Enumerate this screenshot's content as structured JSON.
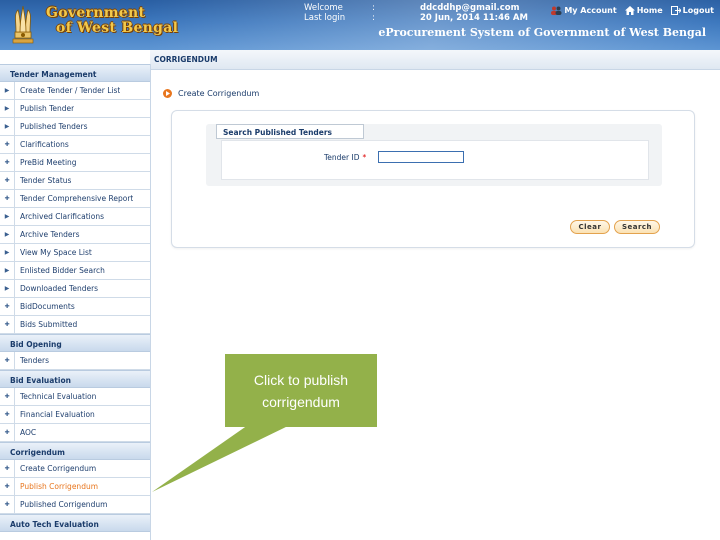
{
  "header": {
    "gov_line1": "Government",
    "gov_line2": "of West Bengal",
    "welcome_label": "Welcome",
    "welcome_value": "ddcddhp@gmail.com",
    "lastlogin_label": "Last login",
    "lastlogin_value": "20 Jun, 2014 11:46 AM",
    "colon": ":",
    "my_account": "My Account",
    "home": "Home",
    "logout": "Logout",
    "system_title": "eProcurement System of Government of West Bengal"
  },
  "breadcrumb": "CORRIGENDUM",
  "sidebar": {
    "tender_management": {
      "title": "Tender Management",
      "items": [
        "Create Tender / Tender List",
        "Publish Tender",
        "Published Tenders",
        "Clarifications",
        "PreBid Meeting",
        "Tender Status",
        "Tender Comprehensive Report",
        "Archived Clarifications",
        "Archive Tenders",
        "View My Space List",
        "Enlisted Bidder Search",
        "Downloaded Tenders",
        "BidDocuments",
        "Bids Submitted"
      ]
    },
    "bid_opening": {
      "title": "Bid Opening",
      "items": [
        "Tenders"
      ]
    },
    "bid_evaluation": {
      "title": "Bid Evaluation",
      "items": [
        "Technical Evaluation",
        "Financial Evaluation",
        "AOC"
      ]
    },
    "corrigendum": {
      "title": "Corrigendum",
      "items": [
        "Create Corrigendum",
        "Publish Corrigendum",
        "Published Corrigendum"
      ]
    },
    "auto_tech": {
      "title": "Auto Tech Evaluation"
    }
  },
  "main": {
    "heading": "Create Corrigendum",
    "search_legend": "Search Published Tenders",
    "tender_id_label": "Tender ID",
    "required_mark": "*",
    "tender_id_value": "",
    "clear_label": "Clear",
    "search_label": "Search"
  },
  "callout": {
    "text": "Click to publish corrigendum"
  },
  "colors": {
    "header_blue": "#3d78be",
    "accent_orange": "#e8761e",
    "callout_green": "#93b14a"
  }
}
